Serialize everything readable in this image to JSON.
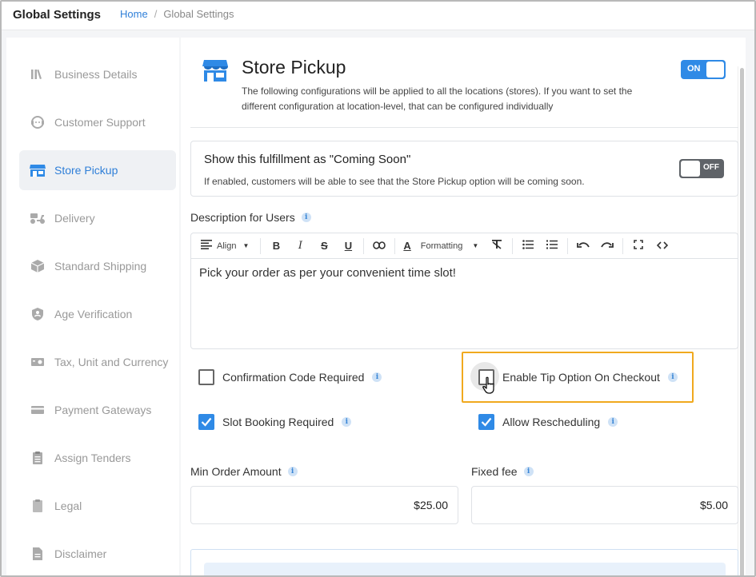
{
  "header": {
    "app_title": "Global Settings",
    "breadcrumb": {
      "home": "Home",
      "separator": "/",
      "current": "Global Settings"
    }
  },
  "sidebar": {
    "items": [
      {
        "label": "Business Details",
        "icon": "library-icon",
        "active": false
      },
      {
        "label": "Customer Support",
        "icon": "support-agent-icon",
        "active": false
      },
      {
        "label": "Store Pickup",
        "icon": "storefront-icon",
        "active": true
      },
      {
        "label": "Delivery",
        "icon": "delivery-scooter-icon",
        "active": false
      },
      {
        "label": "Standard Shipping",
        "icon": "package-icon",
        "active": false
      },
      {
        "label": "Age Verification",
        "icon": "shield-person-icon",
        "active": false
      },
      {
        "label": "Tax, Unit and Currency",
        "icon": "cash-icon",
        "active": false
      },
      {
        "label": "Payment Gateways",
        "icon": "credit-card-icon",
        "active": false
      },
      {
        "label": "Assign Tenders",
        "icon": "clipboard-list-icon",
        "active": false
      },
      {
        "label": "Legal",
        "icon": "document-icon",
        "active": false
      },
      {
        "label": "Disclaimer",
        "icon": "file-text-icon",
        "active": false
      }
    ]
  },
  "main": {
    "title": "Store Pickup",
    "description": "The following configurations will be applied to all the locations (stores). If you want to set the different configuration at location-level, that can be configured individually",
    "enabled_toggle": "ON",
    "coming_soon": {
      "title": "Show this fulfillment as \"Coming Soon\"",
      "description": "If enabled, customers will be able to see that the Store Pickup option will be coming soon.",
      "toggle": "OFF"
    },
    "description_for_users": {
      "label": "Description for Users",
      "toolbar": {
        "align": "Align",
        "formatting": "Formatting"
      },
      "content": "Pick your order as per your convenient time slot!"
    },
    "checkboxes": {
      "confirmation_code": {
        "label": "Confirmation Code Required",
        "checked": false
      },
      "enable_tip": {
        "label": "Enable Tip Option On Checkout",
        "checked": false
      },
      "slot_booking": {
        "label": "Slot Booking Required",
        "checked": true
      },
      "allow_rescheduling": {
        "label": "Allow Rescheduling",
        "checked": true
      }
    },
    "min_order_amount": {
      "label": "Min Order Amount",
      "value": "$25.00"
    },
    "fixed_fee": {
      "label": "Fixed fee",
      "value": "$5.00"
    }
  },
  "colors": {
    "accent": "#2f8ae6",
    "link": "#2f7fd8",
    "highlight": "#f0a91e",
    "toggle_off": "#5f6368"
  }
}
